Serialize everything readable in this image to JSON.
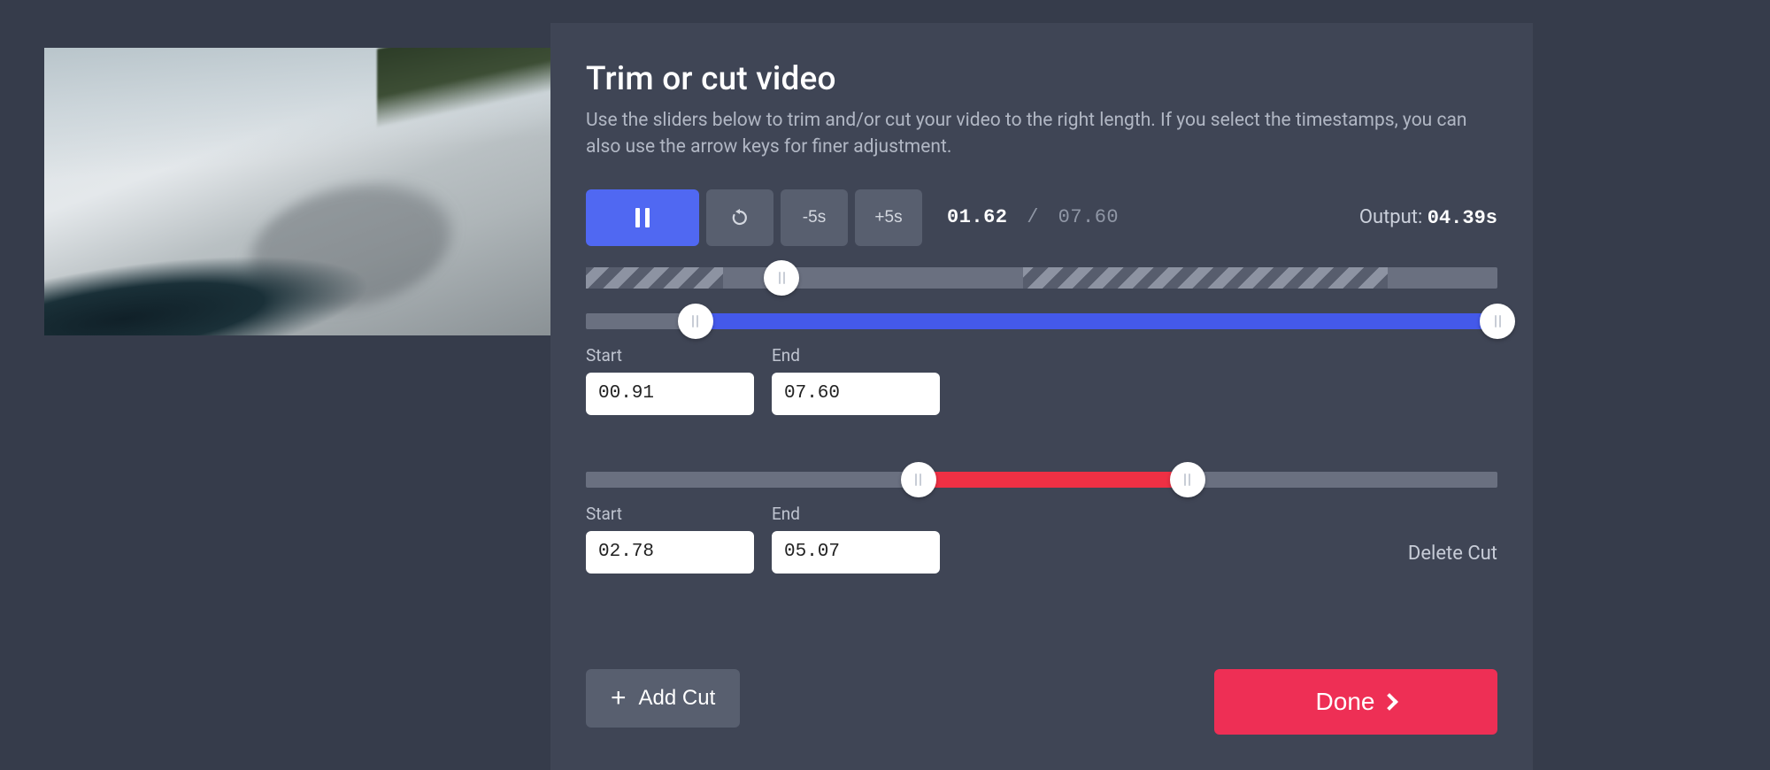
{
  "header": {
    "title": "Trim or cut video",
    "subtitle": "Use the sliders below to trim and/or cut your video to the right length. If you select the timestamps, you can also use the arrow keys for finer adjustment."
  },
  "controls": {
    "back5_label": "-5s",
    "fwd5_label": "+5s",
    "current_time": "01.62",
    "duration": "07.60",
    "output_prefix": "Output: ",
    "output_value": "04.39s"
  },
  "playback_slider": {
    "progress_pct": 21.5,
    "load_a_pct": 0,
    "load_a_w": 15,
    "load_b_pct": 48,
    "load_b_w": 40
  },
  "trim": {
    "start_label": "Start",
    "end_label": "End",
    "start_value": "00.91",
    "end_value": "07.60",
    "start_pct": 12,
    "end_pct": 100
  },
  "cut": {
    "start_label": "Start",
    "end_label": "End",
    "start_value": "02.78",
    "end_value": "05.07",
    "start_pct": 36.5,
    "end_pct": 66,
    "delete_label": "Delete Cut"
  },
  "footer": {
    "addcut_label": "Add Cut",
    "done_label": "Done"
  }
}
